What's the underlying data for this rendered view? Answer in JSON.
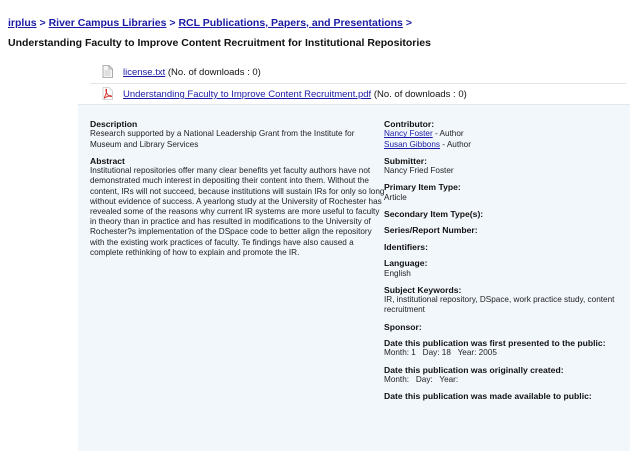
{
  "breadcrumb": {
    "items": [
      "irplus",
      "River Campus Libraries",
      "RCL Publications, Papers, and Presentations"
    ],
    "separator": ">"
  },
  "page_title": "Understanding Faculty to Improve Content Recruitment for Institutional Repositories",
  "files": [
    {
      "name": "license.txt",
      "downloads": "(No. of downloads : 0)",
      "icon": "text-file-icon"
    },
    {
      "name": "Understanding Faculty to Improve Content Recruitment.pdf",
      "downloads": "(No. of downloads : 0)",
      "icon": "pdf-file-icon"
    }
  ],
  "details": {
    "description": {
      "label": "Description",
      "text": "Research supported by a National Leadership Grant from the Institute for Museum and Library Services"
    },
    "abstract": {
      "label": "Abstract",
      "text": "Institutional repositories offer many clear benefits yet faculty authors have not demonstrated much interest in depositing their content into them. Without the content, IRs will not succeed, because institutions will sustain IRs for only so long without evidence of success. A yearlong study at the University of Rochester has revealed some of the reasons why current IR systems are more useful to faculty in theory than in practice and has resulted in modifications to the University of Rochester?s implementation of the DSpace code to better align the repository with the existing work practices of faculty. Te findings have also caused a complete rethinking of how to explain and promote the IR."
    }
  },
  "metadata": {
    "contributor_label": "Contributor:",
    "contributors": [
      {
        "name": "Nancy Foster",
        "role": " - Author"
      },
      {
        "name": "Susan Gibbons",
        "role": " - Author"
      }
    ],
    "submitter_label": "Submitter:",
    "submitter": "Nancy Fried Foster",
    "primary_type_label": "Primary Item Type:",
    "primary_type": "Article",
    "secondary_type_label": "Secondary Item Type(s):",
    "series_label": "Series/Report Number:",
    "identifiers_label": "Identifiers:",
    "language_label": "Language:",
    "language": "English",
    "keywords_label": "Subject Keywords:",
    "keywords": "IR, institutional repository, DSpace, work practice study, content recruitment",
    "sponsor_label": "Sponsor:",
    "first_presented_label": "Date this publication was first presented to the public:",
    "first_presented_value": "Month: 1   Day: 18   Year: 2005",
    "originally_created_label": "Date this publication was originally created:",
    "originally_created_value": "Month:   Day:   Year:",
    "made_available_label": "Date this publication was made available to public:"
  }
}
